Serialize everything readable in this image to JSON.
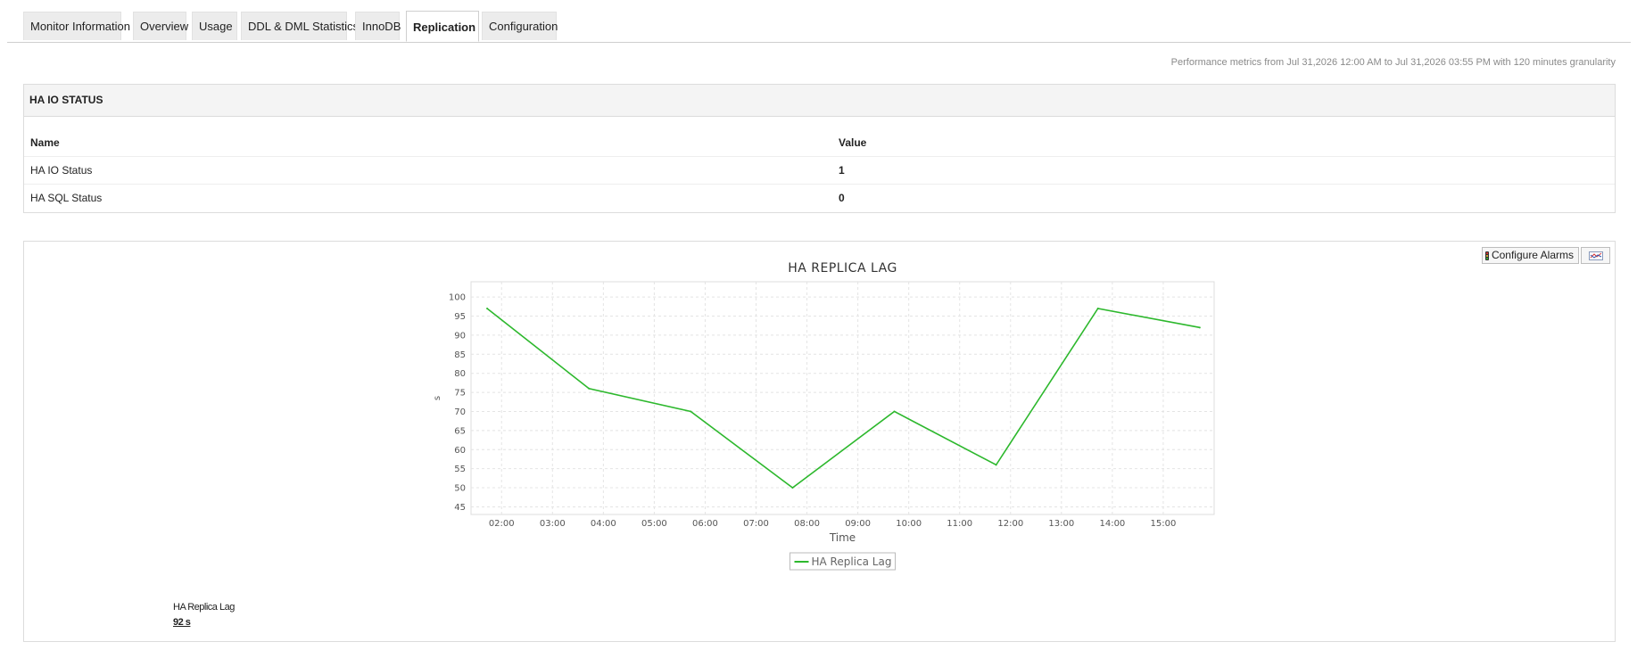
{
  "tabs": [
    {
      "label": "Monitor Information",
      "active": false
    },
    {
      "label": "Overview",
      "active": false
    },
    {
      "label": "Usage",
      "active": false
    },
    {
      "label": "DDL & DML Statistics",
      "active": false
    },
    {
      "label": "InnoDB",
      "active": false
    },
    {
      "label": "Replication",
      "active": true
    },
    {
      "label": "Configuration",
      "active": false
    }
  ],
  "perf_note": "Performance metrics from Jul 31,2026 12:00 AM to Jul 31,2026 03:55 PM with 120 minutes granularity",
  "ha_io_status": {
    "title": "HA IO STATUS",
    "columns": [
      "Name",
      "Value"
    ],
    "rows": [
      {
        "name": "HA IO Status",
        "value": "1"
      },
      {
        "name": "HA SQL Status",
        "value": "0"
      }
    ]
  },
  "chart_panel": {
    "configure_alarms_label": "Configure Alarms",
    "summary_label": "HA Replica Lag",
    "summary_value": "92 s"
  },
  "chart_data": {
    "type": "line",
    "title": "HA REPLICA LAG",
    "xlabel": "Time",
    "ylabel": "s",
    "x_ticks": [
      "02:00",
      "03:00",
      "04:00",
      "05:00",
      "06:00",
      "07:00",
      "08:00",
      "09:00",
      "10:00",
      "11:00",
      "12:00",
      "13:00",
      "14:00",
      "15:00"
    ],
    "y_ticks": [
      45,
      50,
      55,
      60,
      65,
      70,
      75,
      80,
      85,
      90,
      95,
      100
    ],
    "ylim": [
      43,
      104
    ],
    "xlim_hours": [
      1.4,
      16.0
    ],
    "grid": true,
    "legend_position": "bottom-center",
    "series": [
      {
        "name": "HA Replica Lag",
        "color": "#2db82d",
        "x": [
          "01:43",
          "03:43",
          "05:43",
          "07:43",
          "09:43",
          "11:43",
          "13:43",
          "15:43"
        ],
        "values": [
          97,
          76,
          70,
          50,
          70,
          56,
          97,
          92
        ]
      }
    ]
  }
}
